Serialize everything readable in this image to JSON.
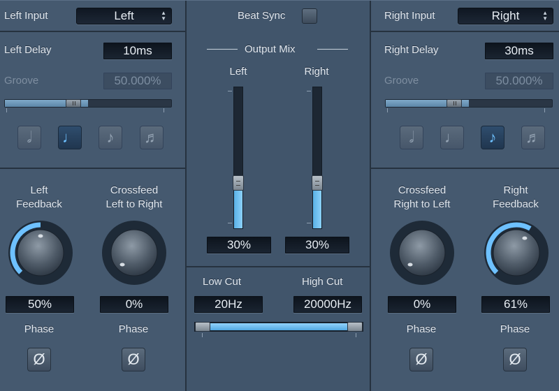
{
  "left": {
    "input_label": "Left Input",
    "input_value": "Left",
    "delay_label": "Left Delay",
    "delay_value": "10ms",
    "groove_label": "Groove",
    "groove_value": "50.000%",
    "groove_level": 0.5,
    "note_buttons": [
      "half-note",
      "quarter-note",
      "eighth-note",
      "sixteenth-note"
    ],
    "active_note": 1,
    "feedback_label_1": "Left",
    "feedback_label_2": "Feedback",
    "feedback_value": "50%",
    "feedback_level": 0.5,
    "crossfeed_label_1": "Crossfeed",
    "crossfeed_label_2": "Left to Right",
    "crossfeed_value": "0%",
    "crossfeed_level": 0.0,
    "phase_label": "Phase",
    "phase_symbol": "Ø"
  },
  "center": {
    "beat_sync_label": "Beat Sync",
    "output_mix_label": "Output Mix",
    "left_label": "Left",
    "right_label": "Right",
    "left_mix_value": "30%",
    "left_mix_level": 0.3,
    "right_mix_value": "30%",
    "right_mix_level": 0.3,
    "low_cut_label": "Low Cut",
    "low_cut_value": "20Hz",
    "high_cut_label": "High Cut",
    "high_cut_value": "20000Hz"
  },
  "right": {
    "input_label": "Right Input",
    "input_value": "Right",
    "delay_label": "Right Delay",
    "delay_value": "30ms",
    "groove_label": "Groove",
    "groove_value": "50.000%",
    "groove_level": 0.5,
    "note_buttons": [
      "half-note",
      "quarter-note",
      "eighth-note",
      "sixteenth-note"
    ],
    "active_note": 2,
    "crossfeed_label_1": "Crossfeed",
    "crossfeed_label_2": "Right to Left",
    "crossfeed_value": "0%",
    "crossfeed_level": 0.0,
    "feedback_label_1": "Right",
    "feedback_label_2": "Feedback",
    "feedback_value": "61%",
    "feedback_level": 0.61,
    "phase_label": "Phase",
    "phase_symbol": "Ø"
  },
  "colors": {
    "panel": "#45596f",
    "accent": "#6ec1ff",
    "knob_ring": "#1e2a37"
  }
}
